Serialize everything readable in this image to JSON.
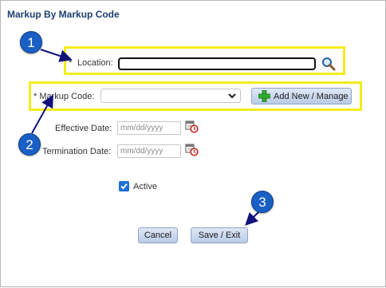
{
  "dialog": {
    "title": "Markup By Markup Code"
  },
  "location": {
    "required_mark": "*",
    "label": "Location:",
    "value": ""
  },
  "markup_code": {
    "label": "* Markup Code:",
    "selected": ""
  },
  "add_button": {
    "label": "Add New / Manage"
  },
  "effective_date": {
    "label": "Effective Date:",
    "placeholder": "mm/dd/yyyy"
  },
  "termination_date": {
    "label": "Termination Date:",
    "placeholder": "mm/dd/yyyy"
  },
  "active": {
    "label": "Active",
    "checked": true
  },
  "buttons": {
    "cancel": "Cancel",
    "save_exit": "Save / Exit"
  },
  "callouts": [
    "1",
    "2",
    "3"
  ],
  "icons": {
    "search": "magnifier-icon",
    "calendar": "calendar-clock-icon",
    "add": "green-plus-icon",
    "dropdown": "chevron-down-icon",
    "check": "checkmark-icon"
  },
  "colors": {
    "highlight": "#f3ec1c",
    "callout": "#1a5fc4",
    "title": "#1c3f6e",
    "arrow": "#12127a"
  }
}
